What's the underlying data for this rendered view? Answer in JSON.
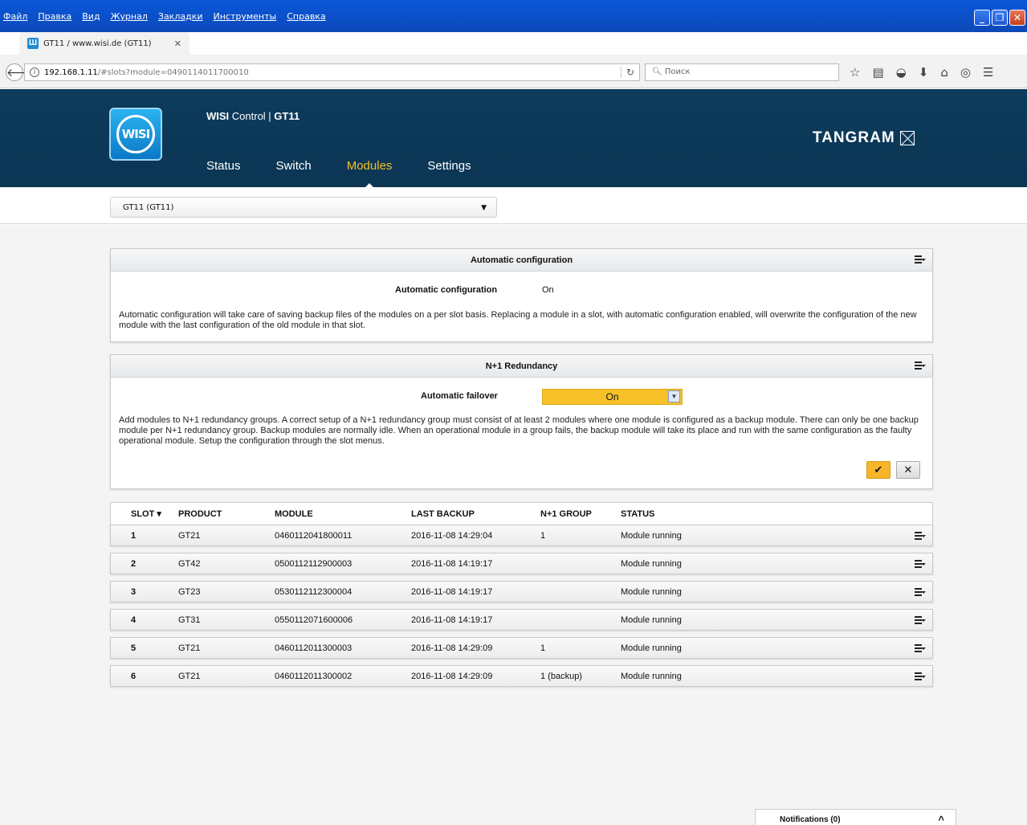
{
  "browser": {
    "menu": [
      "Файл",
      "Правка",
      "Вид",
      "Журнал",
      "Закладки",
      "Инструменты",
      "Справка"
    ],
    "tab_title": "GT11 / www.wisi.de (GT11)",
    "tab_icon": "Ш",
    "url_host": "192.168.1.11",
    "url_rest": "/#slots?module=0490114011700010",
    "search_placeholder": "Поиск"
  },
  "app": {
    "brand_title": "WISI",
    "title_rest": " Control | ",
    "device_bold": "GT11",
    "logo_text": "WISI",
    "tangram": "TANGRAM",
    "nav": [
      "Status",
      "Switch",
      "Modules",
      "Settings"
    ],
    "active_nav": "Modules",
    "device_select": "GT11 (GT11)"
  },
  "auto_config": {
    "title": "Automatic configuration",
    "label": "Automatic configuration",
    "value": "On",
    "description": "Automatic configuration will take care of saving backup files of the modules on a per slot basis. Replacing a module in a slot, with automatic configuration enabled, will overwrite the configuration of the new module with the last configuration of the old module in that slot."
  },
  "redundancy": {
    "title": "N+1 Redundancy",
    "label": "Automatic failover",
    "value": "On",
    "description": "Add modules to N+1 redundancy groups. A correct setup of a N+1 redundancy group must consist of at least 2 modules where one module is configured as a backup module. There can only be one backup module per N+1 redundancy group. Backup modules are normally idle. When an operational module in a group fails, the backup module will take its place and run with the same configuration as the faulty operational module. Setup the configuration through the slot menus.",
    "ok": "✔",
    "cancel": "✕"
  },
  "slots": {
    "headers": {
      "slot": "SLOT ▾",
      "product": "PRODUCT",
      "module": "MODULE",
      "last_backup": "LAST BACKUP",
      "group": "N+1 GROUP",
      "status": "STATUS"
    },
    "rows": [
      {
        "slot": "1",
        "product": "GT21",
        "module": "0460112041800011",
        "last_backup": "2016-11-08 14:29:04",
        "group": "1",
        "status": "Module running"
      },
      {
        "slot": "2",
        "product": "GT42",
        "module": "0500112112900003",
        "last_backup": "2016-11-08 14:19:17",
        "group": "",
        "status": "Module running"
      },
      {
        "slot": "3",
        "product": "GT23",
        "module": "0530112112300004",
        "last_backup": "2016-11-08 14:19:17",
        "group": "",
        "status": "Module running"
      },
      {
        "slot": "4",
        "product": "GT31",
        "module": "0550112071600006",
        "last_backup": "2016-11-08 14:19:17",
        "group": "",
        "status": "Module running"
      },
      {
        "slot": "5",
        "product": "GT21",
        "module": "0460112011300003",
        "last_backup": "2016-11-08 14:29:09",
        "group": "1",
        "status": "Module running"
      },
      {
        "slot": "6",
        "product": "GT21",
        "module": "0460112011300002",
        "last_backup": "2016-11-08 14:29:09",
        "group": "1 (backup)",
        "status": "Module running"
      }
    ]
  },
  "notifications": {
    "label": "Notifications (0)"
  },
  "colors": {
    "header_bg": "#0d3c5c",
    "accent": "#f4c21d",
    "failover_bg": "#f7c12a"
  }
}
